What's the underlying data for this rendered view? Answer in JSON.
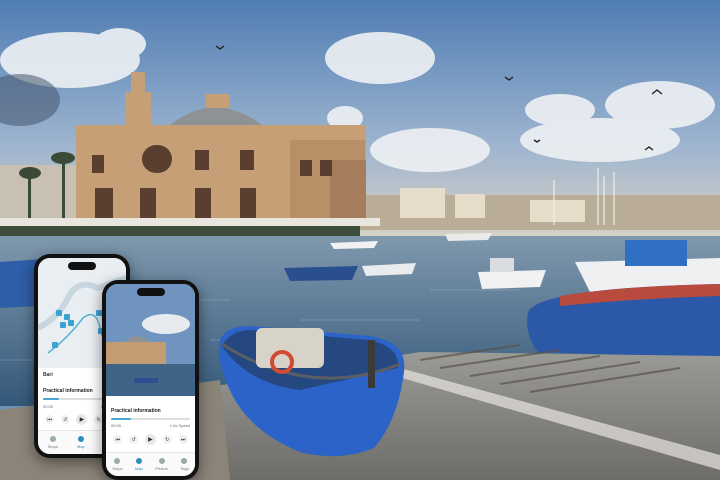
{
  "phones": [
    {
      "screen": "map",
      "map_label": "Bari",
      "card_title": "Practical information",
      "progress_fraction": 0.2,
      "time_left": "00:00",
      "time_right": "1.0x Speed",
      "controls": [
        "prev-icon",
        "rewind-icon",
        "play-icon",
        "forward-icon",
        "next-icon"
      ],
      "tabs": [
        {
          "label": "Stops",
          "icon": "stops-icon",
          "active": false
        },
        {
          "label": "Map",
          "icon": "map-icon",
          "active": true
        },
        {
          "label": "Photos",
          "icon": "photos-icon",
          "active": false
        }
      ]
    },
    {
      "screen": "photo",
      "card_title": "Practical information",
      "progress_fraction": 0.25,
      "time_left": "00:00",
      "time_right": "1.0x Speed",
      "controls": [
        "prev-icon",
        "rewind-icon",
        "play-icon",
        "forward-icon",
        "next-icon"
      ],
      "tabs": [
        {
          "label": "Stops",
          "icon": "stops-icon",
          "active": false
        },
        {
          "label": "Map",
          "icon": "map-icon",
          "active": true
        },
        {
          "label": "Photos",
          "icon": "photos-icon",
          "active": false
        },
        {
          "label": "Tags",
          "icon": "tags-icon",
          "active": false
        }
      ]
    }
  ],
  "colors": {
    "sky_top": "#5d87b8",
    "sky_bottom": "#c9d6e4",
    "sea": "#3a5f84",
    "building": "#c9a27a",
    "boat_blue": "#2f6fc4",
    "accent": "#2d8cc0"
  }
}
